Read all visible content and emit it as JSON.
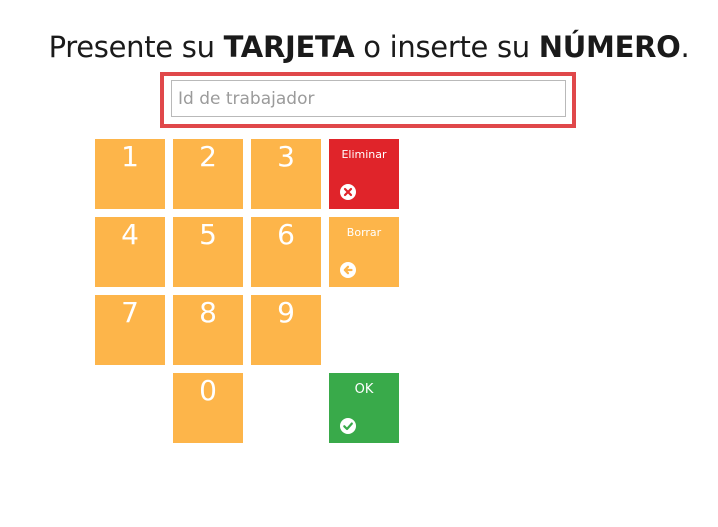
{
  "prompt": {
    "part1": "Presente su ",
    "strong1": "TARJETA",
    "part2": " o inserte su ",
    "strong2": "NÚMERO",
    "part3": "."
  },
  "input": {
    "placeholder": "Id de trabajador",
    "value": ""
  },
  "keypad": {
    "digits": [
      "1",
      "2",
      "3",
      "4",
      "5",
      "6",
      "7",
      "8",
      "9",
      "0"
    ],
    "delete_label": "Eliminar",
    "backspace_label": "Borrar",
    "ok_label": "OK"
  },
  "icons": {
    "delete": "times-circle-icon",
    "backspace": "arrow-left-circle-icon",
    "ok": "check-circle-icon"
  },
  "colors": {
    "digit_key": "#fdb54a",
    "delete_key": "#e0242a",
    "backspace_key": "#fdb54a",
    "ok_key": "#39aa4a",
    "input_highlight": "#e0484a"
  }
}
